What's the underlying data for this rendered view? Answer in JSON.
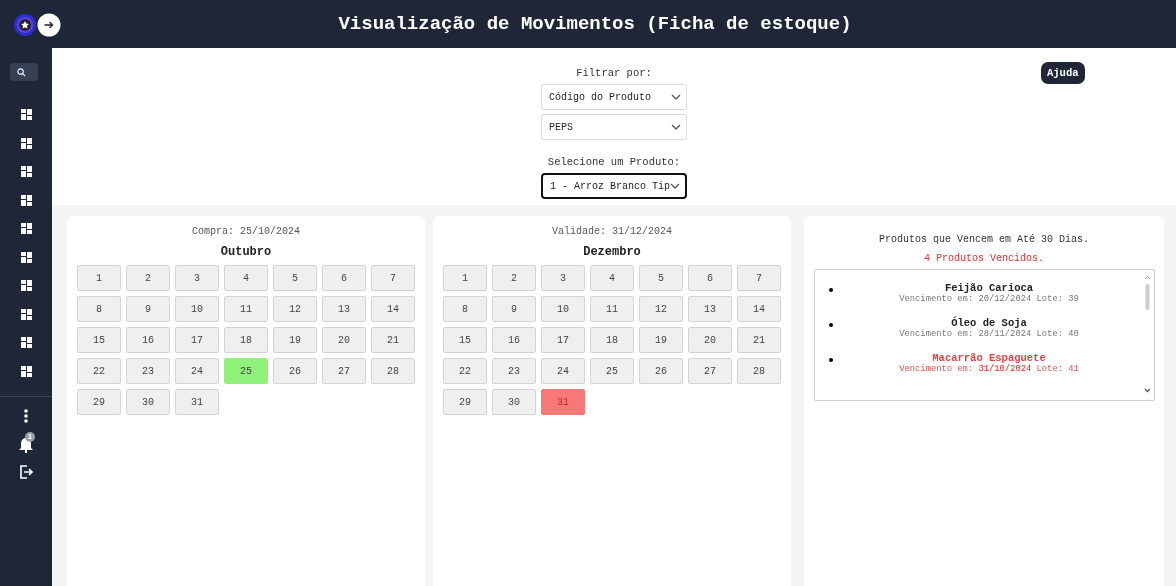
{
  "header": {
    "title": "Visualização de Movimentos (Ficha de estoque)"
  },
  "sidebar": {
    "notification_count": "1",
    "menu": [
      {
        "kind": "grid"
      },
      {
        "kind": "grid"
      },
      {
        "kind": "grid"
      },
      {
        "kind": "grid"
      },
      {
        "kind": "grid"
      },
      {
        "kind": "grid"
      },
      {
        "kind": "grid"
      },
      {
        "kind": "grid"
      },
      {
        "kind": "grid"
      },
      {
        "kind": "grid"
      }
    ]
  },
  "filters": {
    "filter_label": "Filtrar por:",
    "selects": [
      {
        "value": "Código do Produto",
        "focused": false
      },
      {
        "value": "PEPS",
        "focused": false
      }
    ],
    "product_label": "Selecione um Produto:",
    "product_select": {
      "value": "1 - Arroz Branco Tip",
      "focused": true
    },
    "help_button": "Ajuda"
  },
  "calendars": [
    {
      "kind": "purchase",
      "caption": "Compra: 25/10/2024",
      "month": "Outubro",
      "days": [
        {
          "label": "1",
          "selected": false
        },
        {
          "label": "2",
          "selected": false
        },
        {
          "label": "3",
          "selected": false
        },
        {
          "label": "4",
          "selected": false
        },
        {
          "label": "5",
          "selected": false
        },
        {
          "label": "6",
          "selected": false
        },
        {
          "label": "7",
          "selected": false
        },
        {
          "label": "8",
          "selected": false
        },
        {
          "label": "9",
          "selected": false
        },
        {
          "label": "10",
          "selected": false
        },
        {
          "label": "11",
          "selected": false
        },
        {
          "label": "12",
          "selected": false
        },
        {
          "label": "13",
          "selected": false
        },
        {
          "label": "14",
          "selected": false
        },
        {
          "label": "15",
          "selected": false
        },
        {
          "label": "16",
          "selected": false
        },
        {
          "label": "17",
          "selected": false
        },
        {
          "label": "18",
          "selected": false
        },
        {
          "label": "19",
          "selected": false
        },
        {
          "label": "20",
          "selected": false
        },
        {
          "label": "21",
          "selected": false
        },
        {
          "label": "22",
          "selected": false
        },
        {
          "label": "23",
          "selected": false
        },
        {
          "label": "24",
          "selected": false
        },
        {
          "label": "25",
          "selected": true
        },
        {
          "label": "26",
          "selected": false
        },
        {
          "label": "27",
          "selected": false
        },
        {
          "label": "28",
          "selected": false
        },
        {
          "label": "29",
          "selected": false
        },
        {
          "label": "30",
          "selected": false
        },
        {
          "label": "31",
          "selected": false
        }
      ]
    },
    {
      "kind": "expiry",
      "caption": "Validade: 31/12/2024",
      "month": "Dezembro",
      "days": [
        {
          "label": "1",
          "selected": false
        },
        {
          "label": "2",
          "selected": false
        },
        {
          "label": "3",
          "selected": false
        },
        {
          "label": "4",
          "selected": false
        },
        {
          "label": "5",
          "selected": false
        },
        {
          "label": "6",
          "selected": false
        },
        {
          "label": "7",
          "selected": false
        },
        {
          "label": "8",
          "selected": false
        },
        {
          "label": "9",
          "selected": false
        },
        {
          "label": "10",
          "selected": false
        },
        {
          "label": "11",
          "selected": false
        },
        {
          "label": "12",
          "selected": false
        },
        {
          "label": "13",
          "selected": false
        },
        {
          "label": "14",
          "selected": false
        },
        {
          "label": "15",
          "selected": false
        },
        {
          "label": "16",
          "selected": false
        },
        {
          "label": "17",
          "selected": false
        },
        {
          "label": "18",
          "selected": false
        },
        {
          "label": "19",
          "selected": false
        },
        {
          "label": "20",
          "selected": false
        },
        {
          "label": "21",
          "selected": false
        },
        {
          "label": "22",
          "selected": false
        },
        {
          "label": "23",
          "selected": false
        },
        {
          "label": "24",
          "selected": false
        },
        {
          "label": "25",
          "selected": false
        },
        {
          "label": "26",
          "selected": false
        },
        {
          "label": "27",
          "selected": false
        },
        {
          "label": "28",
          "selected": false
        },
        {
          "label": "29",
          "selected": false
        },
        {
          "label": "30",
          "selected": false
        },
        {
          "label": "31",
          "selected": true
        }
      ]
    }
  ],
  "expiring": {
    "title": "Produtos que Vencem em Até 30 Dias.",
    "expired_count": "4 Produtos Vencidos.",
    "items": [
      {
        "name": "Feijão Carioca",
        "label": "Vencimento em:",
        "date": "20/12/2024",
        "lot": "Lote: 39",
        "expired": false
      },
      {
        "name": "Óleo de Soja",
        "label": "Vencimento em:",
        "date": "28/11/2024",
        "lot": "Lote: 40",
        "expired": false
      },
      {
        "name": "Macarrão Espaguete",
        "label": "Vencimento em:",
        "date": "31/10/2024",
        "lot": "Lote: 41",
        "expired": true
      }
    ]
  }
}
